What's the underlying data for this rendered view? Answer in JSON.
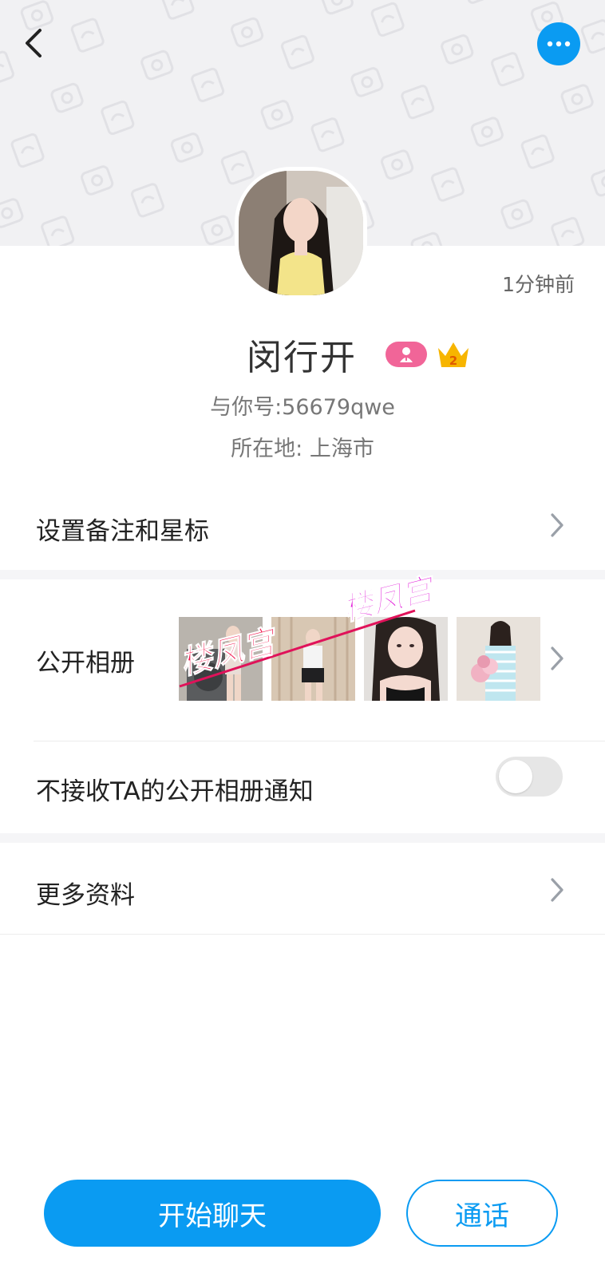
{
  "profile": {
    "last_active": "1分钟前",
    "name": "闵行开",
    "account": "与你号:56679qwe",
    "location": "所在地: 上海市",
    "badges": [
      "person-badge-icon",
      "crown-level-icon"
    ],
    "crown_level": "2"
  },
  "menu": {
    "remark": "设置备注和星标",
    "album": "公开相册",
    "album_notify": "不接收TA的公开相册通知",
    "album_notify_enabled": false,
    "more_info": "更多资料"
  },
  "watermark": {
    "text": "楼凤宫"
  },
  "actions": {
    "chat": "开始聊天",
    "call": "通话"
  },
  "colors": {
    "accent": "#0a9bf2",
    "badge_pink": "#f16598",
    "crown": "#f7b500",
    "watermark": "#f0124a"
  }
}
